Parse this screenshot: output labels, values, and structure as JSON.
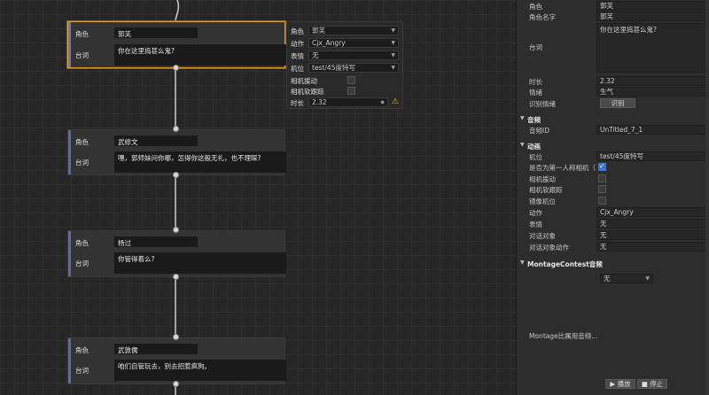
{
  "nodes": [
    {
      "role_label": "角色",
      "role": "郭芙",
      "line_label": "台词",
      "line": "你在这里捣甚么鬼?"
    },
    {
      "role_label": "角色",
      "role": "武修文",
      "line_label": "台词",
      "line": "嘿，郭师妹问你哪，怎得你这般无礼，也不理睬?"
    },
    {
      "role_label": "角色",
      "role": "杨过",
      "line_label": "台词",
      "line": "你管得着么?"
    },
    {
      "role_label": "角色",
      "role": "武敦儒",
      "line_label": "台词",
      "line": "咱们自管玩去，别去招惹疯狗。"
    }
  ],
  "popup": {
    "role_label": "角色",
    "role": "郭芙",
    "action_label": "动作",
    "action": "Cjx_Angry",
    "expr_label": "表情",
    "expr": "无",
    "cam_label": "机位",
    "cam": "test/45度特写",
    "cam_shake_label": "相机援动",
    "cam_soft_label": "相机软跟踪",
    "duration_label": "时长",
    "duration": "2.32"
  },
  "inspector": {
    "role_label": "角色",
    "role": "郭芙",
    "role_name_label": "角色名字",
    "role_name": "郭芙",
    "line_label": "台词",
    "line": "你在这里捣甚么鬼?",
    "duration_label": "时长",
    "duration": "2.32",
    "emotion_label": "情绪",
    "emotion": "生气",
    "recognize_label": "识别情绪",
    "recognize_btn": "识别",
    "audio_section": "音频",
    "audio_id_label": "音频ID",
    "audio_id": "UnTitled_7_1",
    "anim_section": "动画",
    "cam_label": "机位",
    "cam": "test/45度特写",
    "first_person_label": "是否为第一人称相机（",
    "cam_shake_label": "相机援动",
    "cam_soft_label": "相机软跟踪",
    "lens_label": "镜像机位",
    "action_label": "动作",
    "action": "Cjx_Angry",
    "expr_label": "表情",
    "expr": "无",
    "target_label": "对话对象",
    "target": "无",
    "target_action_label": "对话对象动作",
    "target_action": "无",
    "montage_section": "MontageContest音频",
    "montage_select": "无",
    "montage_ratio_label": "Montage比属用音频...",
    "play_btn": "播放",
    "stop_btn": "停止"
  }
}
